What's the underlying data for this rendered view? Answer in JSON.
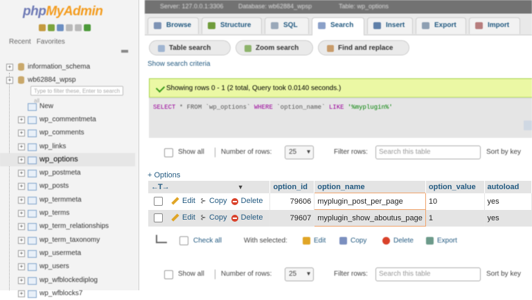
{
  "sidebar": {
    "logo_php": "php",
    "logo_myadmin": "MyAdmin",
    "icon_colors": [
      "#c49a3e",
      "#7ba43e",
      "#6b8ec2",
      "#b9b9b9",
      "#b9b9b9",
      "#4c9a3a"
    ],
    "tab_recent": "Recent",
    "tab_favorites": "Favorites",
    "filter_placeholder": "Type to filter these, Enter to search all",
    "items": [
      {
        "label": "information_schema",
        "kind": "db"
      },
      {
        "label": "wb62884_wpsp",
        "kind": "db"
      },
      {
        "label": "New",
        "kind": "new"
      },
      {
        "label": "wp_commentmeta",
        "kind": "table"
      },
      {
        "label": "wp_comments",
        "kind": "table"
      },
      {
        "label": "wp_links",
        "kind": "table"
      },
      {
        "label": "wp_options",
        "kind": "table"
      },
      {
        "label": "wp_postmeta",
        "kind": "table"
      },
      {
        "label": "wp_posts",
        "kind": "table"
      },
      {
        "label": "wp_termmeta",
        "kind": "table"
      },
      {
        "label": "wp_terms",
        "kind": "table"
      },
      {
        "label": "wp_term_relationships",
        "kind": "table"
      },
      {
        "label": "wp_term_taxonomy",
        "kind": "table"
      },
      {
        "label": "wp_usermeta",
        "kind": "table"
      },
      {
        "label": "wp_users",
        "kind": "table"
      },
      {
        "label": "wp_wfblockediplog",
        "kind": "table"
      },
      {
        "label": "wp_wfblocks7",
        "kind": "table"
      }
    ],
    "active_item": "wp_options"
  },
  "breadcrumb": {
    "server": "Server: 127.0.0.1:3306",
    "database": "Database: wb62884_wpsp",
    "table": "Table: wp_options"
  },
  "tabs": [
    {
      "label": "Browse",
      "color": "#7d93b5"
    },
    {
      "label": "Structure",
      "color": "#6f9c3b"
    },
    {
      "label": "SQL",
      "color": "#9aa8b9"
    },
    {
      "label": "Search",
      "color": "#8aa0c8"
    },
    {
      "label": "Insert",
      "color": "#5f7fa8"
    },
    {
      "label": "Export",
      "color": "#8e9fb2"
    },
    {
      "label": "Import",
      "color": "#b77d7d"
    }
  ],
  "active_tab": "Search",
  "subtabs": {
    "table_search": "Table search",
    "zoom_search": "Zoom search",
    "find_replace": "Find and replace"
  },
  "show_criteria": "Show search criteria",
  "success_message": "Showing rows 0 - 1 (2 total, Query took 0.0140 seconds.)",
  "sql": {
    "select": "SELECT",
    "star": "* FROM",
    "table": "`wp_options`",
    "where": "WHERE",
    "col": "`option_name`",
    "like": "LIKE",
    "pattern": "'%myplugin%'"
  },
  "nav_top": {
    "show_all": "Show all",
    "rows_label": "Number of rows:",
    "rows_value": "25",
    "filter_label": "Filter rows:",
    "filter_placeholder": "Search this table",
    "sort_label": "Sort by key"
  },
  "options_link": "+ Options",
  "table": {
    "arrows": "←T→",
    "columns": [
      "option_id",
      "option_name",
      "option_value",
      "autoload"
    ],
    "edit_label": "Edit",
    "copy_label": "Copy",
    "delete_label": "Delete",
    "rows": [
      {
        "option_id": "79606",
        "option_name": "myplugin_post_per_page",
        "option_value": "10",
        "autoload": "yes"
      },
      {
        "option_id": "79607",
        "option_name": "myplugin_show_aboutus_page",
        "option_value": "1",
        "autoload": "yes"
      }
    ]
  },
  "with_selected": {
    "check_all": "Check all",
    "label": "With selected:",
    "edit": "Edit",
    "copy": "Copy",
    "delete": "Delete",
    "export": "Export"
  },
  "nav_bottom": {
    "show_all": "Show all",
    "rows_label": "Number of rows:",
    "rows_value": "25",
    "filter_label": "Filter rows:",
    "filter_placeholder": "Search this table",
    "sort_label": "Sort by key"
  }
}
